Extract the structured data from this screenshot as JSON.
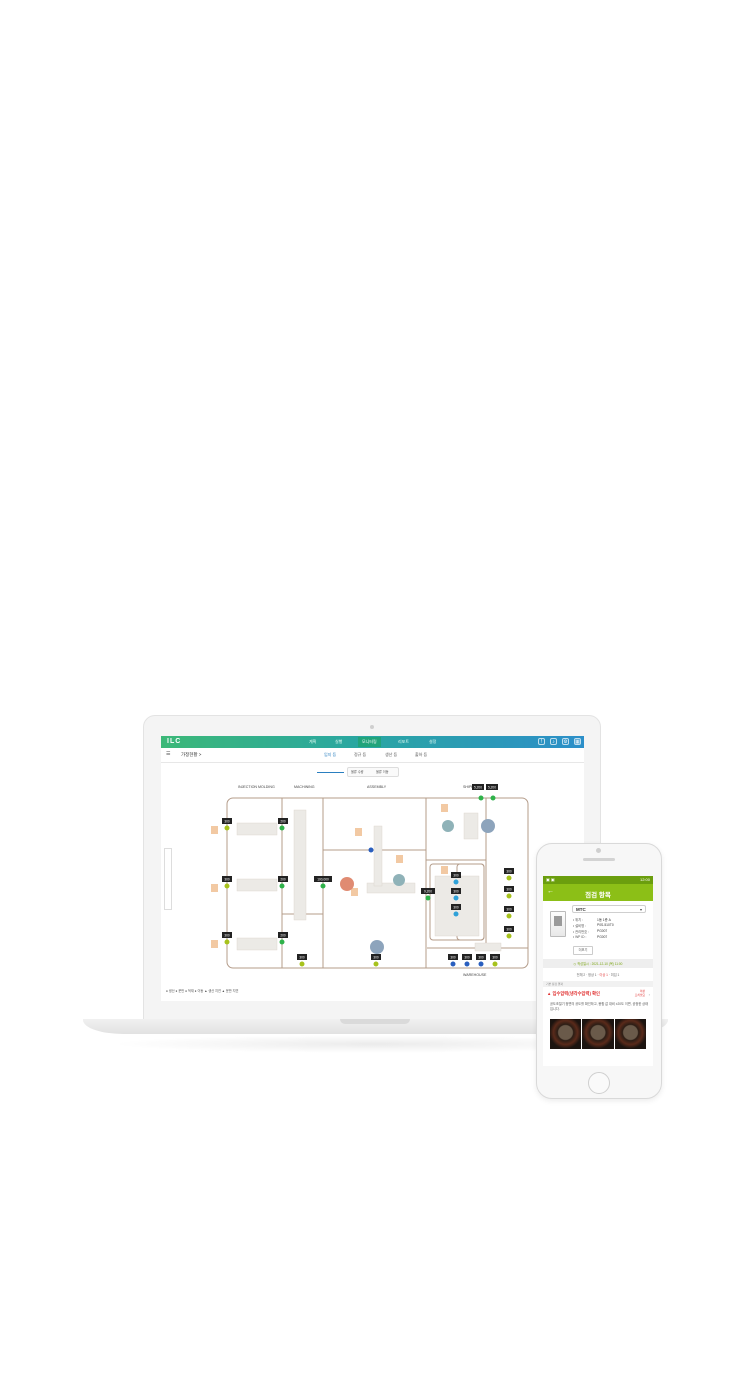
{
  "laptop": {
    "app": {
      "logo": "ILC",
      "nav": [
        "계획",
        "실행",
        "모니터링",
        "리포트",
        "설정"
      ],
      "active_nav": "모니터링",
      "top_icons": [
        "warning-icon",
        "bell-icon",
        "settings-icon",
        "grid-icon"
      ],
      "breadcrumb": "가정현황 >",
      "sub_tabs": [
        "입지 등",
        "정규 등",
        "생산 등",
        "출하 등"
      ],
      "active_sub_tab": "입지 등",
      "toggle": [
        "물류 수량",
        "물류 이동"
      ]
    },
    "zones": {
      "injection": "INJECTION MOLDING",
      "machining": "MACHINING",
      "assembly": "ASSEMBLY",
      "shipping": "SHIPPING",
      "warehouse": "WAREHOUSE"
    },
    "badges": [
      "300",
      "300",
      "300",
      "200",
      "200",
      "200",
      "100,000",
      "300",
      "300",
      "9,200",
      "300",
      "300",
      "300",
      "300",
      "300",
      "300",
      "300",
      "300",
      "300",
      "300",
      "300",
      "300",
      "5,200",
      "5,200"
    ],
    "legend": "● 생산  ● 운반  ● 적재  ● 이동    ▲ 생산 지연  ▲ 운반 지연",
    "colors": {
      "gradient_start": "#3cb878",
      "gradient_end": "#2c8fc9",
      "route": "#b49c8a",
      "machine": "#f2c9a3",
      "green_node": "#2fb24a",
      "blue_node": "#2a5fbf",
      "yellow_node": "#a7c21c"
    }
  },
  "phone": {
    "status_time": "12:00",
    "title": "점검 항목",
    "equipment": "MTC",
    "info": [
      {
        "label": "• 위치 :",
        "value": "1동 1층 A"
      },
      {
        "label": "• 설비명 :",
        "value": "P0S-510T0"
      },
      {
        "label": "• 관리번호 :",
        "value": "PG007"
      },
      {
        "label": "• WP ID :",
        "value": "PG007"
      }
    ],
    "more_label": "더보기",
    "date_line": "◷ 작성일시 : 2021-12-10 (목) 11:00",
    "counts": {
      "total": "전체 2",
      "normal": "정상 1",
      "fail": "이상 1",
      "other": "미입 1"
    },
    "section_label": "기본 점검 결과",
    "item_title": "▲ 입수압력(냉각수압력) 확인",
    "item_badge": "이상\n조치필요",
    "item_desc": "공도조절기 정면의 공도를 확인하고, 봉합 값 대비 ±20도 이면, 공정한 상태입니다.",
    "photos": 3,
    "colors": {
      "appbar": "#8cbf17",
      "statusbar": "#6b9e0e",
      "alert": "#e03030"
    }
  }
}
